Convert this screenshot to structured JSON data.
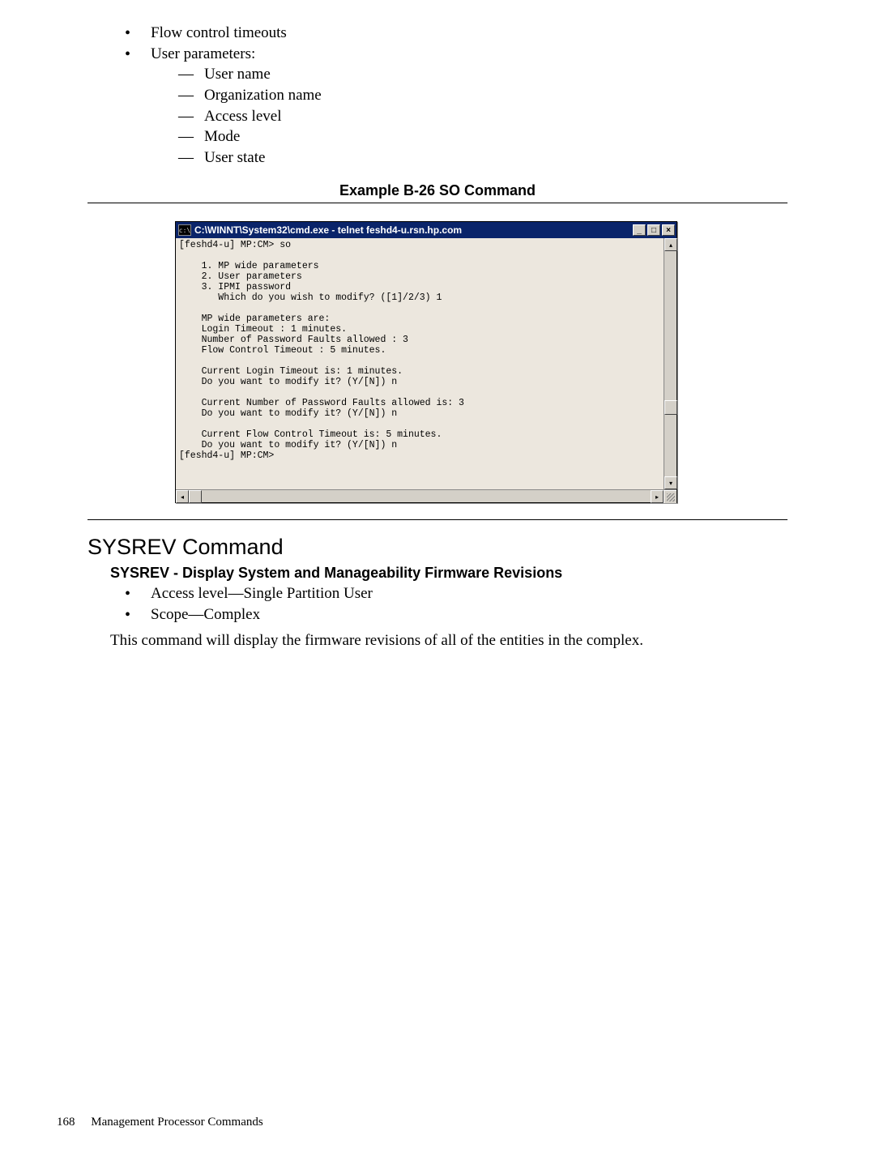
{
  "top_bullets": {
    "items": [
      "Flow control timeouts",
      "User parameters:"
    ],
    "sub_items": [
      "User name",
      "Organization name",
      "Access level",
      "Mode",
      "User state"
    ]
  },
  "example": {
    "caption": "Example B-26 SO Command"
  },
  "terminal": {
    "icon_text": "c:\\",
    "title": "C:\\WINNT\\System32\\cmd.exe - telnet feshd4-u.rsn.hp.com",
    "content": "[feshd4-u] MP:CM> so\n\n    1. MP wide parameters\n    2. User parameters\n    3. IPMI password\n       Which do you wish to modify? ([1]/2/3) 1\n\n    MP wide parameters are:\n    Login Timeout : 1 minutes.\n    Number of Password Faults allowed : 3\n    Flow Control Timeout : 5 minutes.\n\n    Current Login Timeout is: 1 minutes.\n    Do you want to modify it? (Y/[N]) n\n\n    Current Number of Password Faults allowed is: 3\n    Do you want to modify it? (Y/[N]) n\n\n    Current Flow Control Timeout is: 5 minutes.\n    Do you want to modify it? (Y/[N]) n\n[feshd4-u] MP:CM>\n"
  },
  "section": {
    "heading": "SYSREV Command",
    "subhead": "SYSREV - Display System and Manageability Firmware Revisions",
    "bullets": [
      "Access level—Single Partition User",
      "Scope—Complex"
    ],
    "body": "This command will display the firmware revisions of all of the entities in the complex."
  },
  "footer": {
    "page": "168",
    "label": "Management Processor Commands"
  }
}
